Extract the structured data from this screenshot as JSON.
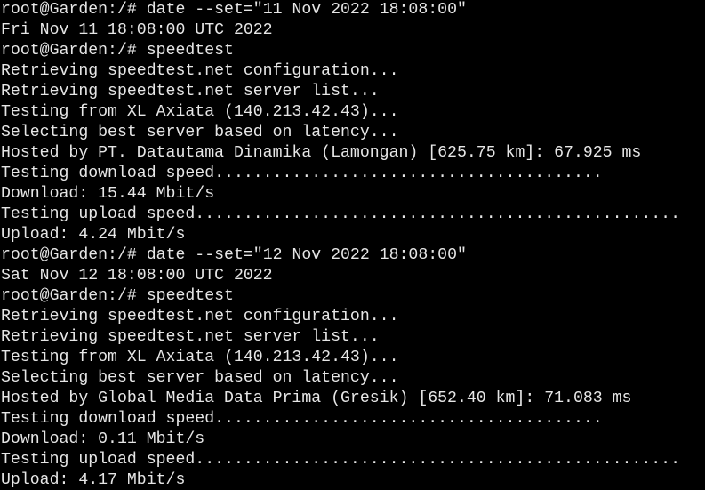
{
  "terminal": {
    "lines": [
      {
        "type": "prompt",
        "prompt": "root@Garden:/#",
        "command": "date --set=\"11 Nov 2022 18:08:00\""
      },
      {
        "type": "output",
        "text": "Fri Nov 11 18:08:00 UTC 2022"
      },
      {
        "type": "prompt",
        "prompt": "root@Garden:/#",
        "command": "speedtest"
      },
      {
        "type": "output",
        "text": "Retrieving speedtest.net configuration..."
      },
      {
        "type": "output",
        "text": "Retrieving speedtest.net server list..."
      },
      {
        "type": "output",
        "text": "Testing from XL Axiata (140.213.42.43)..."
      },
      {
        "type": "output",
        "text": "Selecting best server based on latency..."
      },
      {
        "type": "output",
        "text": "Hosted by PT. Datautama Dinamika (Lamongan) [625.75 km]: 67.925 ms"
      },
      {
        "type": "output",
        "text": "Testing download speed........................................"
      },
      {
        "type": "output",
        "text": "Download: 15.44 Mbit/s"
      },
      {
        "type": "output",
        "text": "Testing upload speed.................................................."
      },
      {
        "type": "output",
        "text": "Upload: 4.24 Mbit/s"
      },
      {
        "type": "prompt",
        "prompt": "root@Garden:/#",
        "command": "date --set=\"12 Nov 2022 18:08:00\""
      },
      {
        "type": "output",
        "text": "Sat Nov 12 18:08:00 UTC 2022"
      },
      {
        "type": "prompt",
        "prompt": "root@Garden:/#",
        "command": "speedtest"
      },
      {
        "type": "output",
        "text": "Retrieving speedtest.net configuration..."
      },
      {
        "type": "output",
        "text": "Retrieving speedtest.net server list..."
      },
      {
        "type": "output",
        "text": "Testing from XL Axiata (140.213.42.43)..."
      },
      {
        "type": "output",
        "text": "Selecting best server based on latency..."
      },
      {
        "type": "output",
        "text": "Hosted by Global Media Data Prima (Gresik) [652.40 km]: 71.083 ms"
      },
      {
        "type": "output",
        "text": "Testing download speed........................................"
      },
      {
        "type": "output",
        "text": "Download: 0.11 Mbit/s"
      },
      {
        "type": "output",
        "text": "Testing upload speed.................................................."
      },
      {
        "type": "output",
        "text": "Upload: 4.17 Mbit/s"
      }
    ]
  },
  "colors": {
    "background": "#000000",
    "foreground": "#e6e6e6"
  }
}
